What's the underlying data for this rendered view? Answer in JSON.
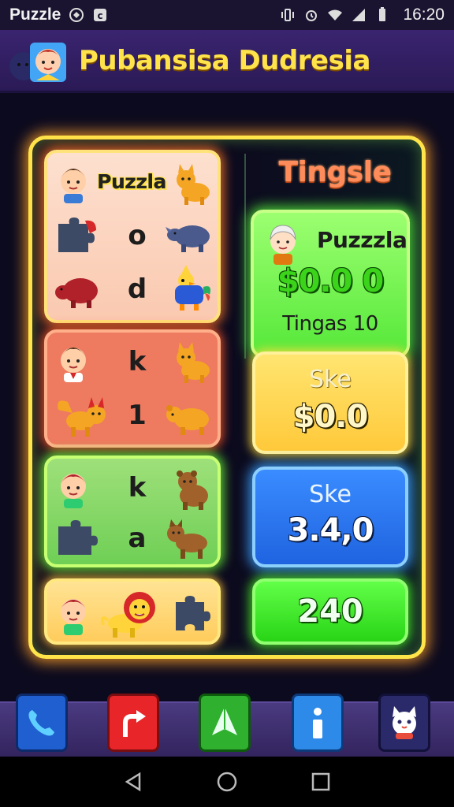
{
  "status_bar": {
    "app_name": "Puzzle",
    "time": "16:20",
    "icons": [
      "app-shield-icon",
      "app-c-icon",
      "vibrate-icon",
      "alarm-icon",
      "wifi-icon",
      "signal-icon",
      "battery-icon"
    ]
  },
  "header": {
    "title": "Pubansisa Dudresia",
    "avatar": "avatar-icon"
  },
  "left_grid": {
    "panel1": {
      "label": "Puzzla",
      "letters": [
        "o",
        "d"
      ],
      "icons": [
        "boy-avatar-icon",
        "orange-cat-icon",
        "puzzle-piece-icon",
        "blue-rhino-icon",
        "red-boar-icon",
        "yellow-bird-icon"
      ]
    },
    "panel2": {
      "letters": [
        "k",
        "1"
      ],
      "icons": [
        "boy-avatar-icon",
        "orange-cat-icon",
        "orange-fox-icon",
        "orange-bear-icon"
      ]
    },
    "panel3": {
      "letters": [
        "k",
        "a"
      ],
      "icons": [
        "boy-avatar-icon",
        "brown-bear-icon",
        "puzzle-piece-icon",
        "brown-dog-icon"
      ]
    },
    "panel4": {
      "icons": [
        "boy-avatar-icon",
        "lion-icon",
        "puzzle-piece-icon"
      ]
    }
  },
  "right_column": {
    "title": "Tingsle",
    "card1": {
      "name": "Puzzzla",
      "amount": "$0.0 0",
      "subtitle": "Tingas 10",
      "avatar": "grandma-avatar-icon"
    },
    "card2": {
      "label": "Ske",
      "value": "$0.0"
    },
    "card3": {
      "label": "Ske",
      "value": "3.4,0"
    },
    "card4": {
      "value": "240"
    }
  },
  "dock": {
    "buttons": [
      "phone-icon",
      "share-arrow-icon",
      "paper-plane-icon",
      "info-icon",
      "cat-icon"
    ],
    "colors": [
      "#1f5fd0",
      "#e8262a",
      "#2fb02f",
      "#2d8ae8",
      "#2a2a6a"
    ]
  },
  "nav": [
    "back-icon",
    "home-icon",
    "recents-icon"
  ]
}
